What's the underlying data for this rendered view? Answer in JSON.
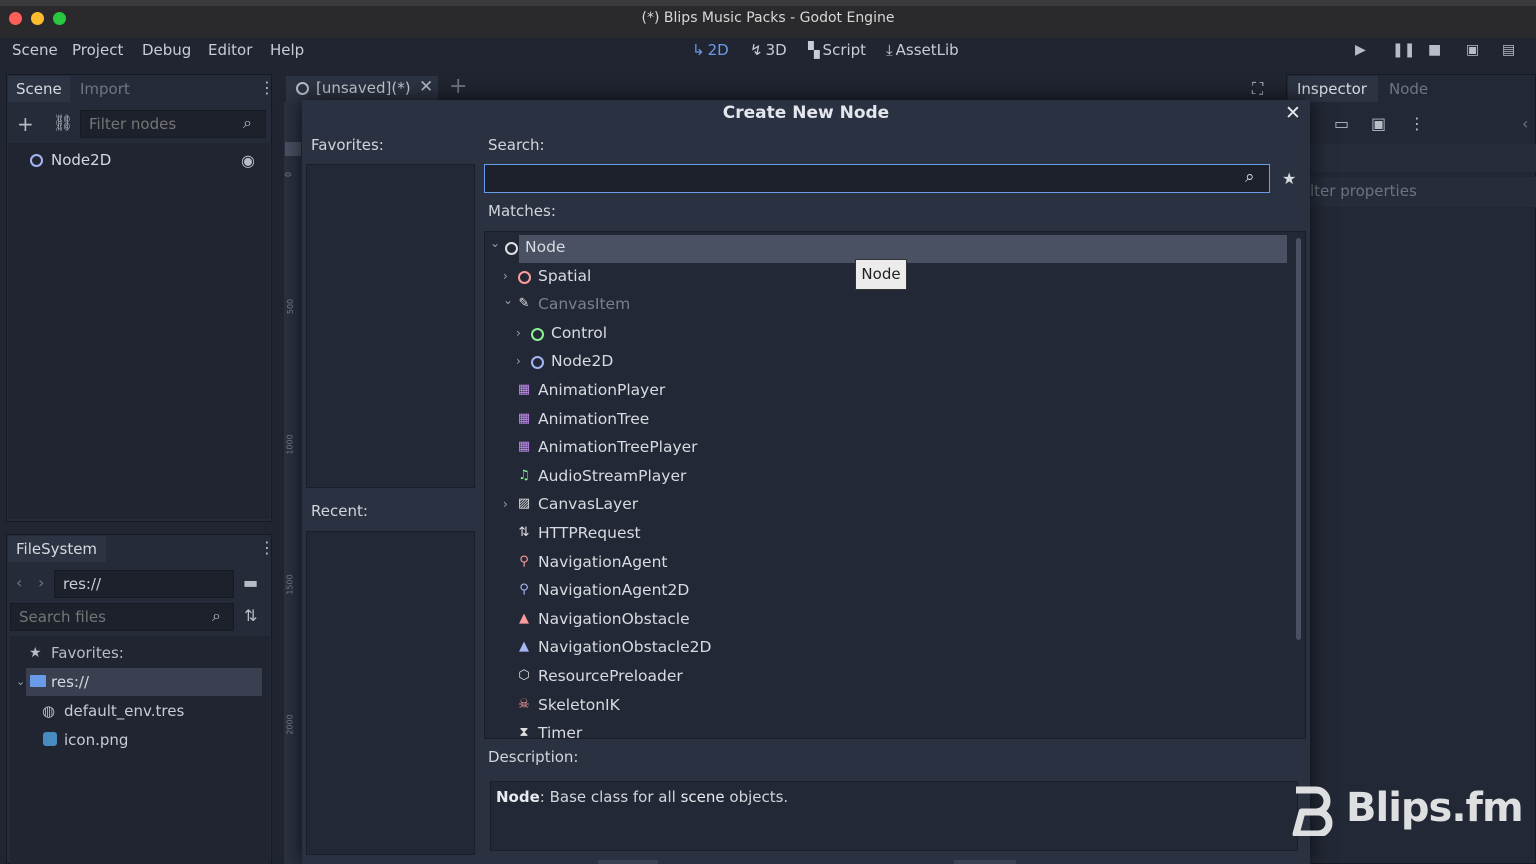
{
  "window": {
    "title": "(*) Blips Music Packs - Godot Engine"
  },
  "menu": {
    "items": [
      "Scene",
      "Project",
      "Debug",
      "Editor",
      "Help"
    ]
  },
  "modes": {
    "m2d": "2D",
    "m3d": "3D",
    "script": "Script",
    "assetlib": "AssetLib"
  },
  "scene_dock": {
    "tab_active": "Scene",
    "tab_inactive": "Import",
    "filter_placeholder": "Filter nodes",
    "root_node": "Node2D"
  },
  "filesystem_dock": {
    "tab": "FileSystem",
    "path": "res://",
    "search_placeholder": "Search files",
    "favorites": "Favorites:",
    "root": "res://",
    "files": [
      "default_env.tres",
      "icon.png"
    ]
  },
  "editor_tab": {
    "label": "[unsaved](*)"
  },
  "ruler": {
    "marks": [
      "0",
      "500",
      "1000",
      "1500",
      "2000"
    ]
  },
  "inspector_dock": {
    "tab_active": "Inspector",
    "tab_inactive": "Node",
    "filter_text": "lter properties"
  },
  "dialog": {
    "title": "Create New Node",
    "favorites_label": "Favorites:",
    "recent_label": "Recent:",
    "search_label": "Search:",
    "search_value": "",
    "matches_label": "Matches:",
    "description_label": "Description:",
    "description": {
      "name": "Node",
      "pre": ": Base class for all ",
      "link": "scene",
      "post": " objects."
    },
    "tooltip": "Node",
    "tree": [
      {
        "label": "Node",
        "depth": 0,
        "arrow": "open",
        "icon": "ring",
        "color": "#e0e0e0",
        "selected": true
      },
      {
        "label": "Spatial",
        "depth": 1,
        "arrow": "closed",
        "icon": "ring",
        "color": "#fc9c9c"
      },
      {
        "label": "CanvasItem",
        "depth": 1,
        "arrow": "open",
        "icon": "brush",
        "color": "#e0e0e0",
        "dim": true
      },
      {
        "label": "Control",
        "depth": 2,
        "arrow": "closed",
        "icon": "ring",
        "color": "#8eef97"
      },
      {
        "label": "Node2D",
        "depth": 2,
        "arrow": "closed",
        "icon": "ring",
        "color": "#a5b7f3"
      },
      {
        "label": "AnimationPlayer",
        "depth": 1,
        "arrow": "none",
        "icon": "film",
        "color": "#c38ef1"
      },
      {
        "label": "AnimationTree",
        "depth": 1,
        "arrow": "none",
        "icon": "film",
        "color": "#c38ef1"
      },
      {
        "label": "AnimationTreePlayer",
        "depth": 1,
        "arrow": "none",
        "icon": "film",
        "color": "#c38ef1"
      },
      {
        "label": "AudioStreamPlayer",
        "depth": 1,
        "arrow": "none",
        "icon": "note",
        "color": "#8eef97"
      },
      {
        "label": "CanvasLayer",
        "depth": 1,
        "arrow": "closed",
        "icon": "layer",
        "color": "#e0e0e0"
      },
      {
        "label": "HTTPRequest",
        "depth": 1,
        "arrow": "none",
        "icon": "http",
        "color": "#e0e0e0"
      },
      {
        "label": "NavigationAgent",
        "depth": 1,
        "arrow": "none",
        "icon": "pin",
        "color": "#fc9c9c"
      },
      {
        "label": "NavigationAgent2D",
        "depth": 1,
        "arrow": "none",
        "icon": "pin",
        "color": "#a5b7f3"
      },
      {
        "label": "NavigationObstacle",
        "depth": 1,
        "arrow": "none",
        "icon": "cone",
        "color": "#fc9c9c"
      },
      {
        "label": "NavigationObstacle2D",
        "depth": 1,
        "arrow": "none",
        "icon": "cone",
        "color": "#a5b7f3"
      },
      {
        "label": "ResourcePreloader",
        "depth": 1,
        "arrow": "none",
        "icon": "cube",
        "color": "#e0e0e0"
      },
      {
        "label": "SkeletonIK",
        "depth": 1,
        "arrow": "none",
        "icon": "skull",
        "color": "#fc9c9c"
      },
      {
        "label": "Timer",
        "depth": 1,
        "arrow": "none",
        "icon": "hourglass",
        "color": "#e0e0e0"
      }
    ]
  },
  "watermark": {
    "text": "Blips.fm"
  },
  "colors": {
    "accent": "#699ce8",
    "bg": "#202531",
    "panel": "#252b38"
  }
}
